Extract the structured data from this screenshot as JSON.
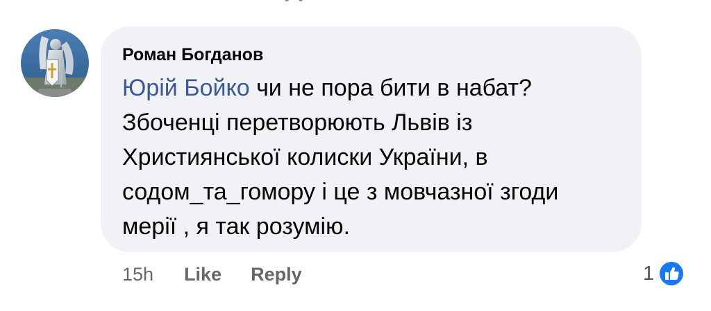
{
  "comment": {
    "author": "Роман Богданов",
    "mention": "Юрій Бойко",
    "lines": [
      " чи не пора бити в набат?",
      "Збоченці перетворюють Львів із",
      "Християнської колиски України, в",
      "содом_та_гомору і це з мовчазної згоди",
      "мерії , я так розумію."
    ]
  },
  "actions": {
    "timestamp": "15h",
    "like_label": "Like",
    "reply_label": "Reply"
  },
  "reactions": {
    "count": "1",
    "icon": "thumbs-up-icon",
    "color": "#1877f2"
  },
  "colors": {
    "bubble": "#f0f2f5",
    "mention": "#385898",
    "meta": "#65676b"
  }
}
